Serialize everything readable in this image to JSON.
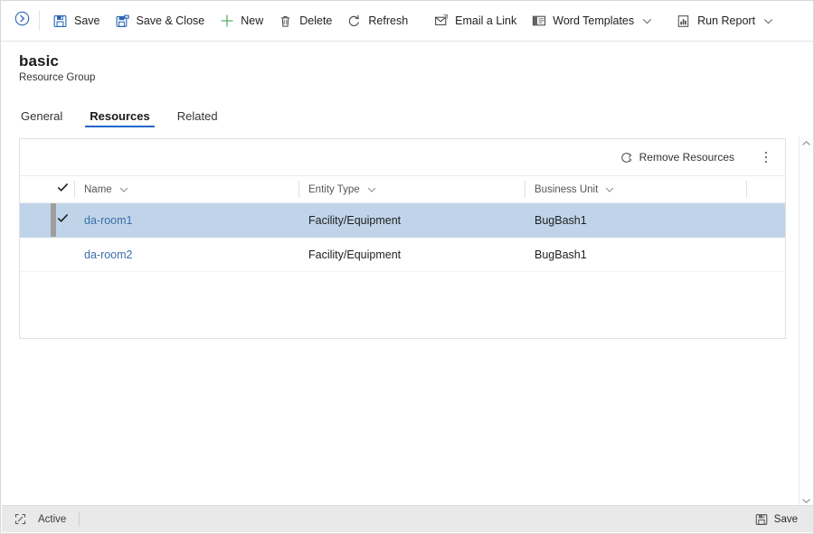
{
  "commandbar": {
    "expand_icon": "circle-chevron-right-icon",
    "buttons": [
      {
        "label": "Save",
        "icon": "save-floppy-icon",
        "caret": false
      },
      {
        "label": "Save & Close",
        "icon": "save-and-close-icon",
        "caret": false
      },
      {
        "label": "New",
        "icon": "plus-icon",
        "caret": false
      },
      {
        "label": "Delete",
        "icon": "trash-icon",
        "caret": false
      },
      {
        "label": "Refresh",
        "icon": "refresh-icon",
        "caret": false
      },
      {
        "label": "Email a Link",
        "icon": "email-link-icon",
        "caret": false
      },
      {
        "label": "Word Templates",
        "icon": "word-template-icon",
        "caret": true
      },
      {
        "label": "Run Report",
        "icon": "run-report-icon",
        "caret": true
      }
    ]
  },
  "header": {
    "title": "basic",
    "subtitle": "Resource Group"
  },
  "tabs": [
    {
      "label": "General",
      "selected": false
    },
    {
      "label": "Resources",
      "selected": true
    },
    {
      "label": "Related",
      "selected": false
    }
  ],
  "grid": {
    "toolbar": {
      "remove_label": "Remove Resources",
      "remove_icon": "remove-resource-icon",
      "overflow_icon": "more-vertical-icon"
    },
    "select_all_icon": "checkmark-icon",
    "columns": [
      {
        "label": "Name",
        "sort_icon": "chevron-down-icon"
      },
      {
        "label": "Entity Type",
        "sort_icon": "chevron-down-icon"
      },
      {
        "label": "Business Unit",
        "sort_icon": "chevron-down-icon"
      }
    ],
    "rows": [
      {
        "selected": true,
        "check_icon": "checkmark-icon",
        "name": "da-room1",
        "entity_type": "Facility/Equipment",
        "business_unit": "BugBash1"
      },
      {
        "selected": false,
        "check_icon": "",
        "name": "da-room2",
        "entity_type": "Facility/Equipment",
        "business_unit": "BugBash1"
      }
    ]
  },
  "scrollbar": {
    "up_icon": "caret-up-icon",
    "down_icon": "caret-down-icon"
  },
  "footer": {
    "resize_icon": "resize-grip-icon",
    "status": "Active",
    "save_label": "Save",
    "save_icon": "save-floppy-icon"
  },
  "colors": {
    "accent_blue": "#2266cc",
    "link_blue": "#3b6fa8",
    "row_selected": "#bfd4e8",
    "new_green": "#5aac6b",
    "footer_bg": "#e9e9e9"
  }
}
